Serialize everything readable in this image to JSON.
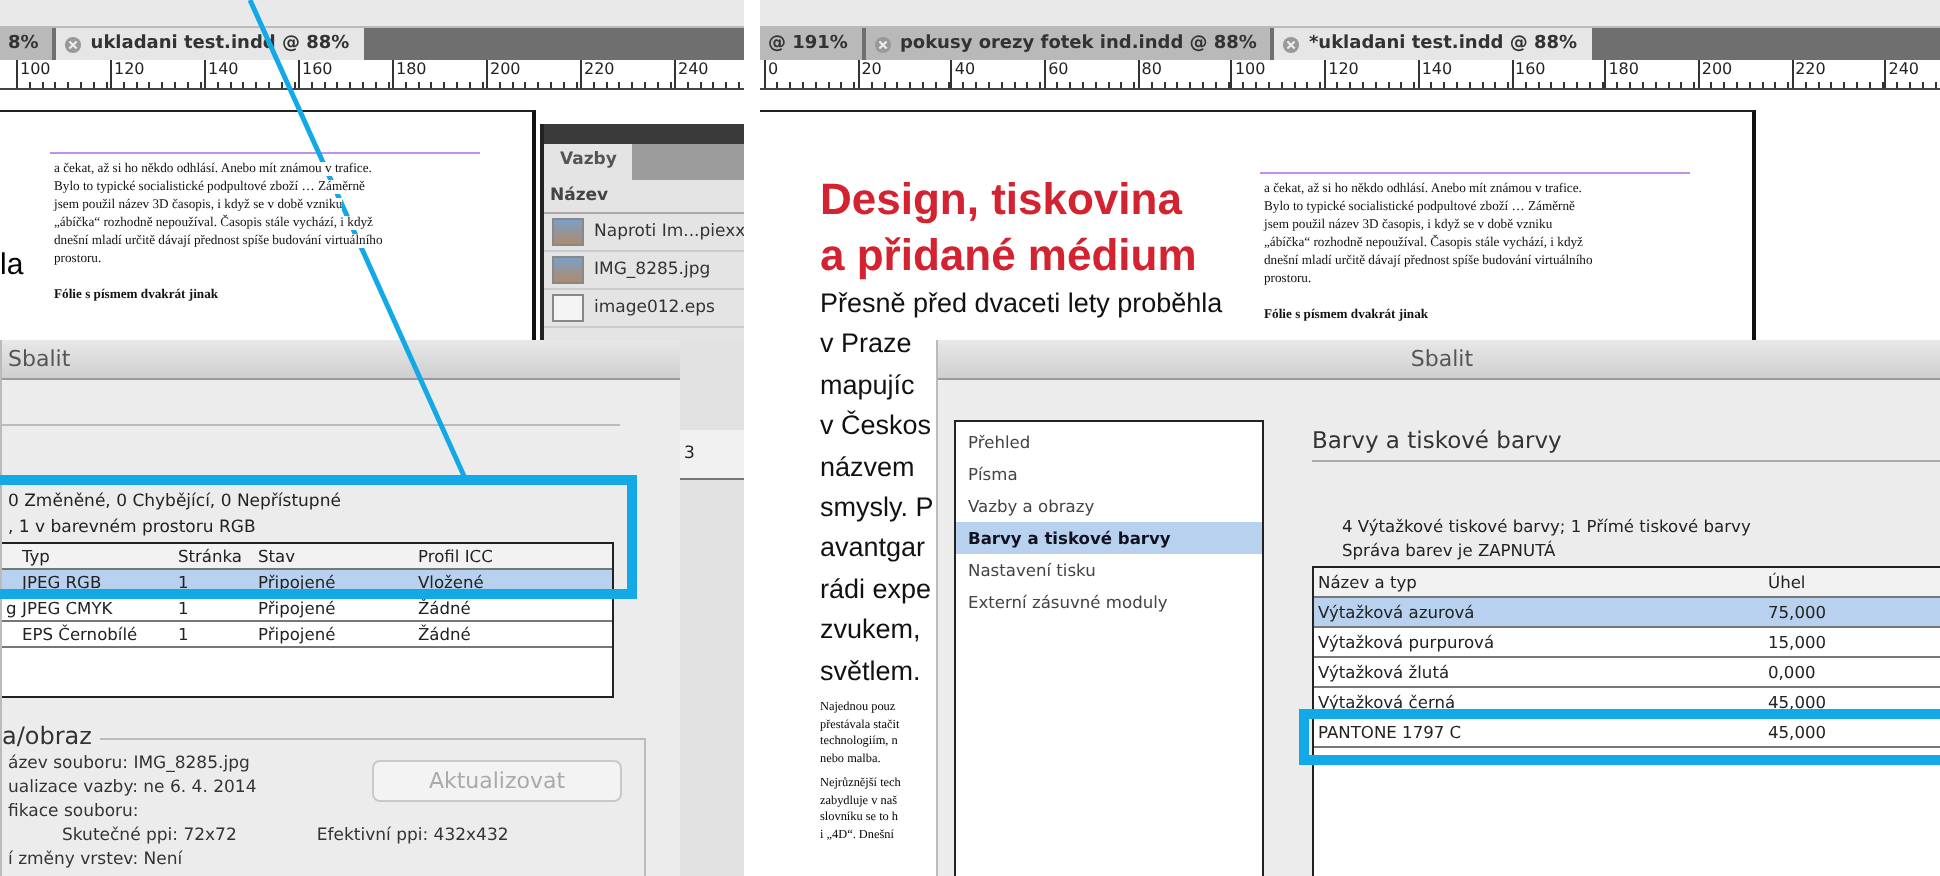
{
  "left_window": {
    "tabs": [
      {
        "label": "8%",
        "closable": false,
        "selected": false
      },
      {
        "label": "ukladani test.indd @ 88%",
        "closable": true,
        "selected": true
      }
    ],
    "ruler": [
      "100",
      "120",
      "140",
      "160",
      "180",
      "200",
      "220",
      "240"
    ],
    "page": {
      "fragment": "la",
      "column_lines": [
        "a čekat, až si ho někdo odhlásí. Anebo mít známou v trafice.",
        "Bylo to typické socialistické podpultové zboží … Záměrně",
        "jsem použil název 3D časopis, i když se v době vzniku",
        "„ábíčka“ rozhodně nepoužíval. Časopis stále vychází, i když",
        "dnešní mladí určitě dávají přednost spíše budování virtuálního",
        "prostoru."
      ],
      "subhead": "Fólie s písmem dvakrát jinak"
    },
    "links_panel": {
      "tab": "Vazby",
      "header": "Název",
      "items": [
        {
          "name": "Naproti Im...piexx",
          "kind": "photo"
        },
        {
          "name": "IMG_8285.jpg",
          "kind": "photo"
        },
        {
          "name": "image012.eps",
          "kind": "eps"
        }
      ]
    },
    "side_label": "3",
    "dialog": {
      "title": "Sbalit",
      "summary": [
        "0 Změněné, 0 Chybějící, 0 Nepřístupné",
        ", 1 v barevném prostoru RGB"
      ],
      "columns": [
        "Typ",
        "Stránka",
        "Stav",
        "Profil ICC"
      ],
      "rows": [
        {
          "type": "JPEG RGB",
          "page": "1",
          "status": "Připojené",
          "profile": "Vložené",
          "selected": true
        },
        {
          "file": "g",
          "type": "JPEG CMYK",
          "page": "1",
          "status": "Připojené",
          "profile": "Žádné",
          "selected": false
        },
        {
          "type": "EPS Černobílé",
          "page": "1",
          "status": "Připojené",
          "profile": "Žádné",
          "selected": false
        }
      ],
      "group": {
        "legend": "a/obraz",
        "lines": [
          "ázev souboru: IMG_8285.jpg",
          "ualizace vazby: ne 6. 4. 2014",
          "fikace souboru:"
        ],
        "actual_ppi": "Skutečné ppi: 72x72",
        "effective_ppi": "Efektivní ppi: 432x432",
        "last_line": "í změny vrstev: Není"
      },
      "button": {
        "label": "Aktualizovat",
        "disabled": true
      }
    }
  },
  "right_window": {
    "tabs": [
      {
        "label": "@ 191%",
        "closable": false,
        "selected": false
      },
      {
        "label": "pokusy orezy fotek ind.indd @ 88%",
        "closable": true,
        "selected": false
      },
      {
        "label": "*ukladani test.indd @ 88%",
        "closable": true,
        "selected": true
      }
    ],
    "ruler": [
      "0",
      "20",
      "40",
      "60",
      "80",
      "100",
      "120",
      "140",
      "160",
      "180",
      "200",
      "220",
      "240"
    ],
    "page": {
      "heading": [
        "Design, tiskovina",
        "a přidané médium"
      ],
      "lead": [
        "Přesně před dvaceti lety proběhla",
        "v Praze",
        "mapujíc",
        "v Českos",
        "názvem",
        "smysly. P",
        "avantgar",
        "rádi expe",
        "zvukem,",
        "světlem."
      ],
      "small_paragraphs": [
        [
          "Najednou pouz",
          "přestávala stačit",
          "technologiím, n",
          "nebo malba."
        ],
        [
          "Nejrůznější tech",
          "zabydluje v naš",
          "slovníku se to h",
          "i „4D“. Dnešní"
        ]
      ],
      "column_lines": [
        "a čekat, až si ho někdo odhlásí. Anebo mít známou v trafice.",
        "Bylo to typické socialistické podpultové zboží … Záměrně",
        "jsem použil název 3D časopis, i když se v době vzniku",
        "„ábíčka“ rozhodně nepoužíval. Časopis stále vychází, i když",
        "dnešní mladí určitě dávají přednost spíše budování virtuálního",
        "prostoru."
      ],
      "subhead": "Fólie s písmem dvakrát jinak"
    },
    "dialog": {
      "title": "Sbalit",
      "nav": [
        {
          "label": "Přehled",
          "selected": false
        },
        {
          "label": "Písma",
          "selected": false
        },
        {
          "label": "Vazby a obrazy",
          "selected": false
        },
        {
          "label": "Barvy a tiskové barvy",
          "selected": true
        },
        {
          "label": "Nastavení tisku",
          "selected": false
        },
        {
          "label": "Externí zásuvné moduly",
          "selected": false
        }
      ],
      "section_title": "Barvy a tiskové barvy",
      "info": [
        "4 Výtažkové tiskové barvy; 1 Přímé tiskové barvy",
        "Správa barev je ZAPNUTÁ"
      ],
      "columns": [
        "Název a typ",
        "Úhel"
      ],
      "rows": [
        {
          "name": "Výtažková azurová",
          "angle": "75,000",
          "selected": true
        },
        {
          "name": "Výtažková purpurová",
          "angle": "15,000",
          "selected": false
        },
        {
          "name": "Výtažková žlutá",
          "angle": "0,000",
          "selected": false
        },
        {
          "name": "Výtažková černá",
          "angle": "45,000",
          "selected": false
        },
        {
          "name": "PANTONE 1797 C",
          "angle": "45,000",
          "selected": false
        }
      ]
    }
  }
}
